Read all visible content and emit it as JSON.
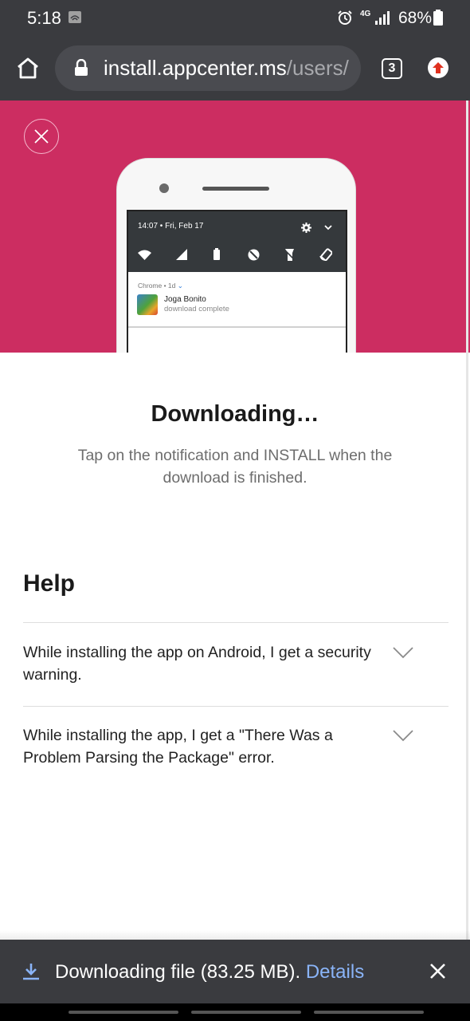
{
  "status_bar": {
    "time": "5:18",
    "network": "4G",
    "battery": "68%"
  },
  "browser": {
    "url_host": "install.appcenter.ms",
    "url_path": "/users/",
    "tab_count": "3"
  },
  "hero": {
    "notif_time": "14:07 • Fri, Feb 17",
    "notif_source": "Chrome • 1d",
    "notif_chevron": "⌄",
    "notif_title": "Joga Bonito",
    "notif_subtitle": "download complete",
    "accent_color": "#cc2d61"
  },
  "main": {
    "title": "Downloading…",
    "subtitle": "Tap on the notification and INSTALL when the download is finished."
  },
  "help": {
    "heading": "Help",
    "items": [
      {
        "label": "While installing the app on Android, I get a security warning."
      },
      {
        "label": "While installing the app, I get a \"There Was a Problem Parsing the Package\" error."
      }
    ]
  },
  "download_bar": {
    "text": "Downloading file (83.25 MB).",
    "link": "Details"
  }
}
